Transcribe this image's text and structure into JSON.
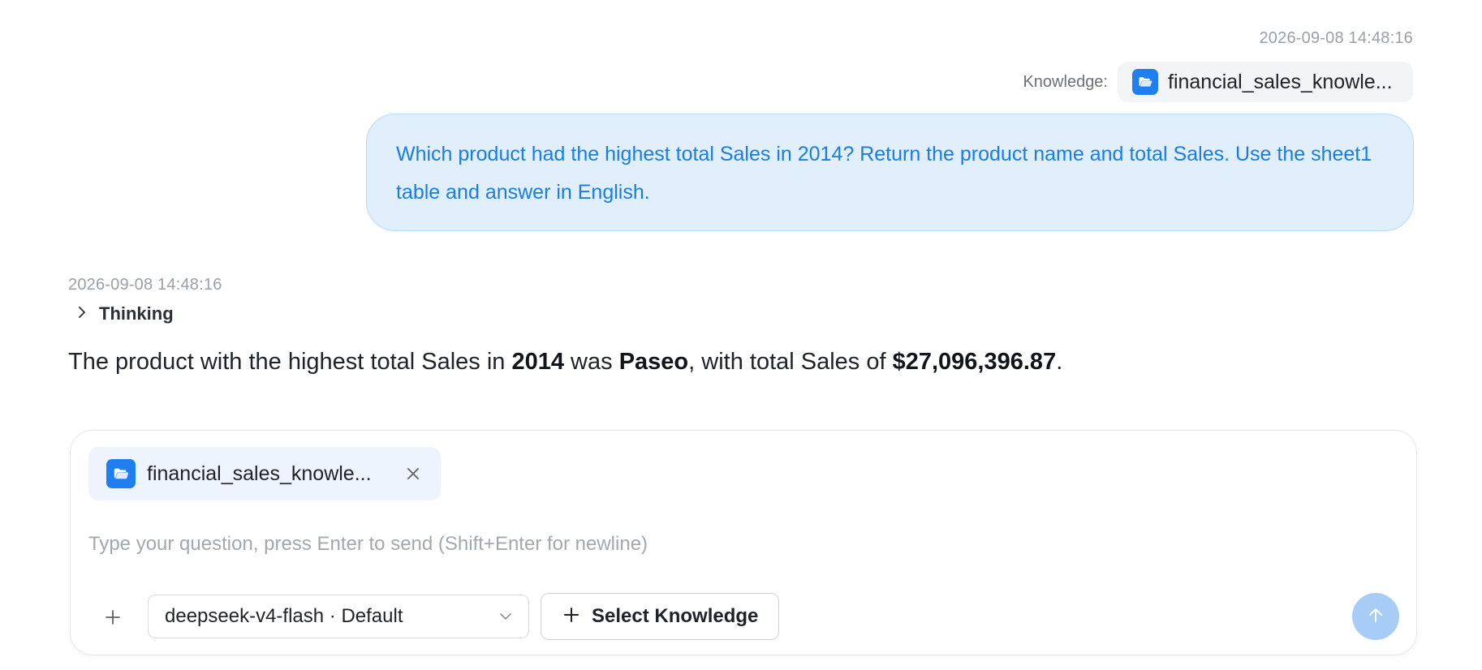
{
  "user_message": {
    "timestamp": "2026-09-08 14:48:16",
    "knowledge_label": "Knowledge:",
    "knowledge_name": "financial_sales_knowle...",
    "text": "Which product had the highest total Sales in 2014? Return the product name and total Sales. Use the sheet1 table and answer in English."
  },
  "assistant_message": {
    "timestamp": "2026-09-08 14:48:16",
    "thinking_label": "Thinking",
    "answer": {
      "part1": "The product with the highest total Sales in ",
      "year": "2014",
      "part2": " was ",
      "product": "Paseo",
      "part3": ", with total Sales of ",
      "amount": "$27,096,396.87",
      "part4": "."
    }
  },
  "composer": {
    "attached_knowledge": "financial_sales_knowle...",
    "placeholder": "Type your question, press Enter to send (Shift+Enter for newline)",
    "value": "",
    "model_label": "deepseek-v4-flash · Default",
    "select_knowledge_label": "Select Knowledge"
  },
  "icons": {
    "folder": "folder-open-icon",
    "chevron_right": "chevron-right-icon",
    "close": "close-icon",
    "plus": "plus-icon",
    "chevron_down": "chevron-down-icon",
    "send": "arrow-up-icon"
  },
  "colors": {
    "accent": "#1f7ff0",
    "bubble_bg": "#e1eefb",
    "bubble_text": "#1a7de3",
    "send_button": "#a7ccf6"
  }
}
